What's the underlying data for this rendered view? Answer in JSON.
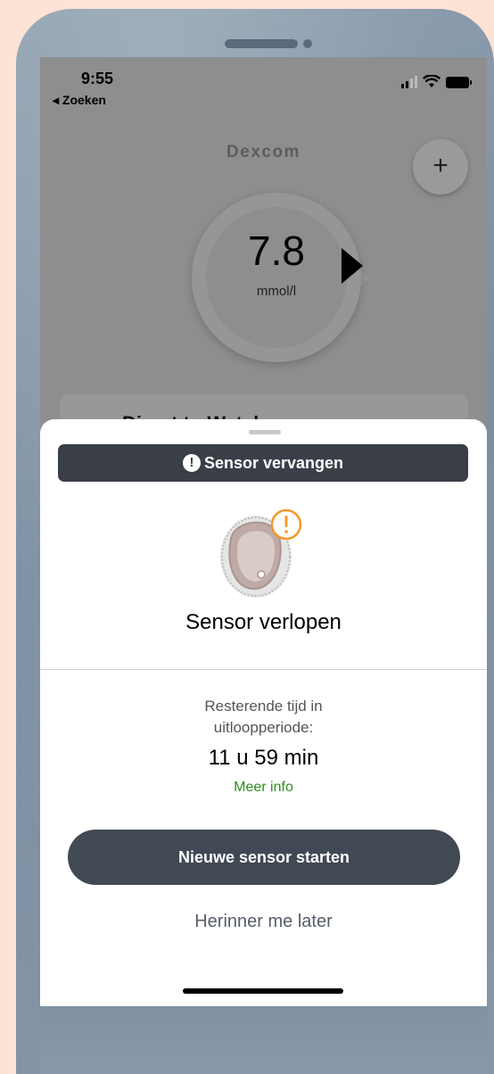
{
  "status_bar": {
    "time": "9:55",
    "back_label": "◂ Zoeken",
    "icons": [
      "cellular-signal-icon",
      "wifi-icon",
      "battery-icon"
    ]
  },
  "app": {
    "logo": "Dexcom",
    "add_button_label": "+",
    "glucose": {
      "value": "7.8",
      "unit": "mmol/l",
      "trend": "right-arrow"
    },
    "card_peek_text": "Direct to Watch"
  },
  "sheet": {
    "banner_icon": "!",
    "banner_title": "Sensor vervangen",
    "sensor_status": "Sensor verlopen",
    "remaining_label_line1": "Resterende tijd in",
    "remaining_label_line2": "uitloopperiode:",
    "remaining_value": "11 u 59 min",
    "more_info_link": "Meer info",
    "primary_button": "Nieuwe sensor starten",
    "secondary_button": "Herinner me later"
  },
  "colors": {
    "banner_bg": "#3a3f47",
    "primary_button_bg": "#414954",
    "link_green": "#2e8b1e",
    "warning_orange": "#f39a2b",
    "page_bg": "#fde3d6"
  }
}
